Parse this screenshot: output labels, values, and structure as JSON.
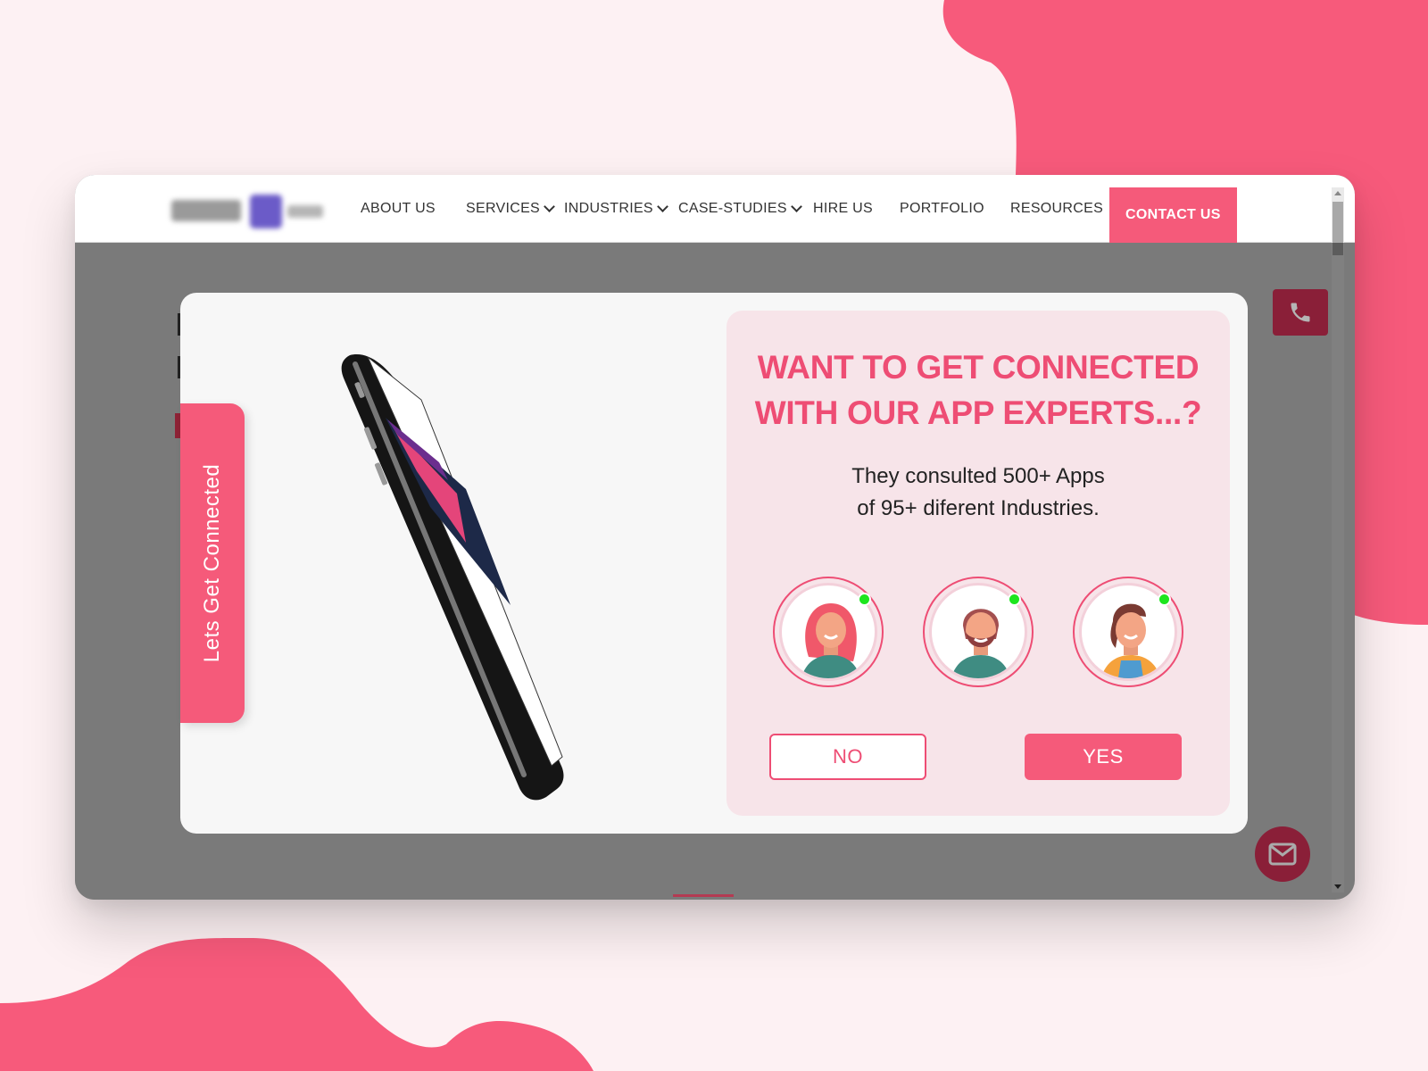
{
  "colors": {
    "accent": "#f55a7a",
    "accent_dark": "#8a1f38",
    "background": "#fdf1f3",
    "panel": "#f7e4e9",
    "online": "#1ee51e"
  },
  "nav": {
    "logo_alt": "blurred company logo",
    "items": [
      {
        "label": "ABOUT US",
        "has_dropdown": false
      },
      {
        "label": "SERVICES",
        "has_dropdown": true
      },
      {
        "label": "INDUSTRIES",
        "has_dropdown": true
      },
      {
        "label": "CASE-STUDIES",
        "has_dropdown": true
      },
      {
        "label": "HIRE US",
        "has_dropdown": false
      },
      {
        "label": "PORTFOLIO",
        "has_dropdown": false
      },
      {
        "label": "RESOURCES",
        "has_dropdown": false
      }
    ],
    "contact_label": "CONTACT US"
  },
  "floating": {
    "phone_icon": "phone-icon",
    "mail_icon": "mail-icon"
  },
  "side_tab": {
    "label": "Lets Get Connected"
  },
  "modal": {
    "title_line1": "WANT TO GET CONNECTED",
    "title_line2": "WITH OUR APP EXPERTS...?",
    "subtitle_line1": "They consulted 500+ Apps",
    "subtitle_line2": "of 95+ diferent Industries.",
    "experts": [
      {
        "name": "expert-woman-red-hair",
        "status": "online"
      },
      {
        "name": "expert-man-beard",
        "status": "online"
      },
      {
        "name": "expert-woman-brown-hair",
        "status": "online"
      }
    ],
    "no_label": "NO",
    "yes_label": "YES"
  }
}
